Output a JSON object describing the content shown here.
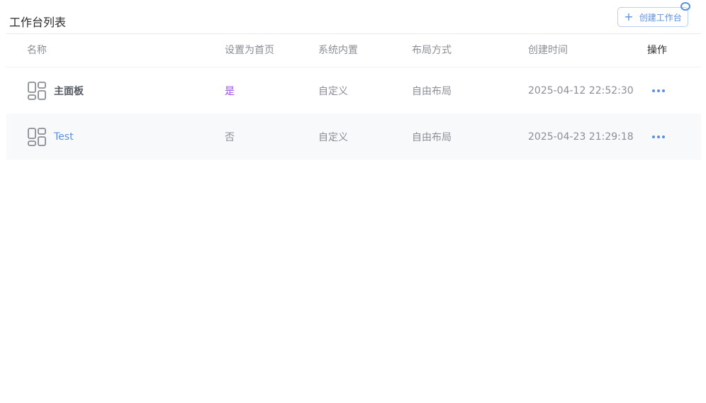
{
  "header": {
    "title": "工作台列表",
    "create_button": {
      "icon": "plus-icon",
      "label": "创建工作台"
    }
  },
  "table": {
    "columns": {
      "name": "名称",
      "home": "设置为首页",
      "system": "系统内置",
      "layout": "布局方式",
      "created": "创建时间",
      "actions": "操作"
    },
    "rows": [
      {
        "name": "主面板",
        "home": "是",
        "system": "自定义",
        "layout": "自由布局",
        "created": "2025-04-12 22:52:30",
        "icon": "dashboard-icon",
        "action_icon": "more-icon"
      },
      {
        "name": "Test",
        "home": "否",
        "system": "自定义",
        "layout": "自由布局",
        "created": "2025-04-23 21:29:18",
        "icon": "dashboard-icon",
        "action_icon": "more-icon"
      }
    ]
  },
  "colors": {
    "accent": "#5b8fde",
    "home_yes": "#9a4ee6",
    "muted_text": "#8b8e96",
    "row_alt_bg": "#f8f9fb"
  }
}
